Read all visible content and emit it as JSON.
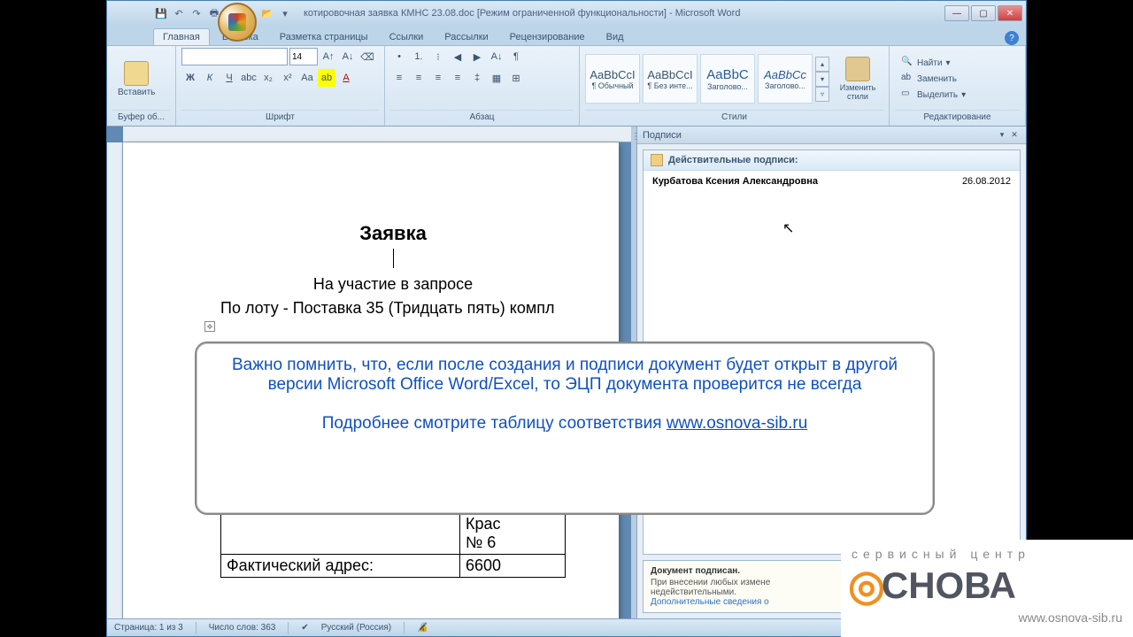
{
  "titlebar": {
    "title": "котировочная заявка КМНС 23.08.doc [Режим ограниченной функциональности] - Microsoft Word"
  },
  "tabs": {
    "home": "Главная",
    "insert": "Вставка",
    "layout": "Разметка страницы",
    "refs": "Ссылки",
    "mail": "Рассылки",
    "review": "Рецензирование",
    "view": "Вид"
  },
  "ribbon": {
    "clipboard": {
      "label": "Буфер об...",
      "paste": "Вставить"
    },
    "font": {
      "label": "Шрифт",
      "name": "",
      "size": "14"
    },
    "para": {
      "label": "Абзац"
    },
    "styles": {
      "label": "Стили",
      "items": [
        {
          "preview": "AaBbCcI",
          "name": "¶ Обычный"
        },
        {
          "preview": "AaBbCcI",
          "name": "¶ Без инте..."
        },
        {
          "preview": "AaBbC",
          "name": "Заголово..."
        },
        {
          "preview": "AaBbCc",
          "name": "Заголово..."
        }
      ],
      "change": "Изменить стили"
    },
    "editing": {
      "label": "Редактирование",
      "find": "Найти",
      "replace": "Заменить",
      "select": "Выделить"
    }
  },
  "document": {
    "heading": "Заявка",
    "subtitle": "На участие в запросе",
    "lot": "По лоту - Поставка 35 (Тридцать пять) компл",
    "row1_left": " ",
    "row1_right_a": "Крас",
    "row1_right_b": "№ 6",
    "row2_left": "Фактический адрес:",
    "row2_right": "6600"
  },
  "signatures": {
    "title": "Подписи",
    "valid_header": "Действительные подписи:",
    "entry": {
      "name": "Курбатова Ксения Александровна",
      "date": "26.08.2012"
    },
    "info_title": "Документ подписан.",
    "info_line1": "При внесении любых измене",
    "info_line2": "недействительными.",
    "info_link": "Дополнительные сведения о"
  },
  "statusbar": {
    "page": "Страница: 1 из 3",
    "words": "Число слов: 363",
    "lang": "Русский (Россия)"
  },
  "callout": {
    "line1": "Важно помнить, что, если после создания и подписи документ будет открыт в другой версии Microsoft Office Word/Excel, то ЭЦП документа проверится не всегда",
    "line2": "Подробнее смотрите таблицу соответствия ",
    "link": "www.osnova-sib.ru"
  },
  "logo": {
    "tagline": "сервисный центр",
    "brand_left": "",
    "brand_text": "СНОВА",
    "url": "www.osnova-sib.ru"
  }
}
